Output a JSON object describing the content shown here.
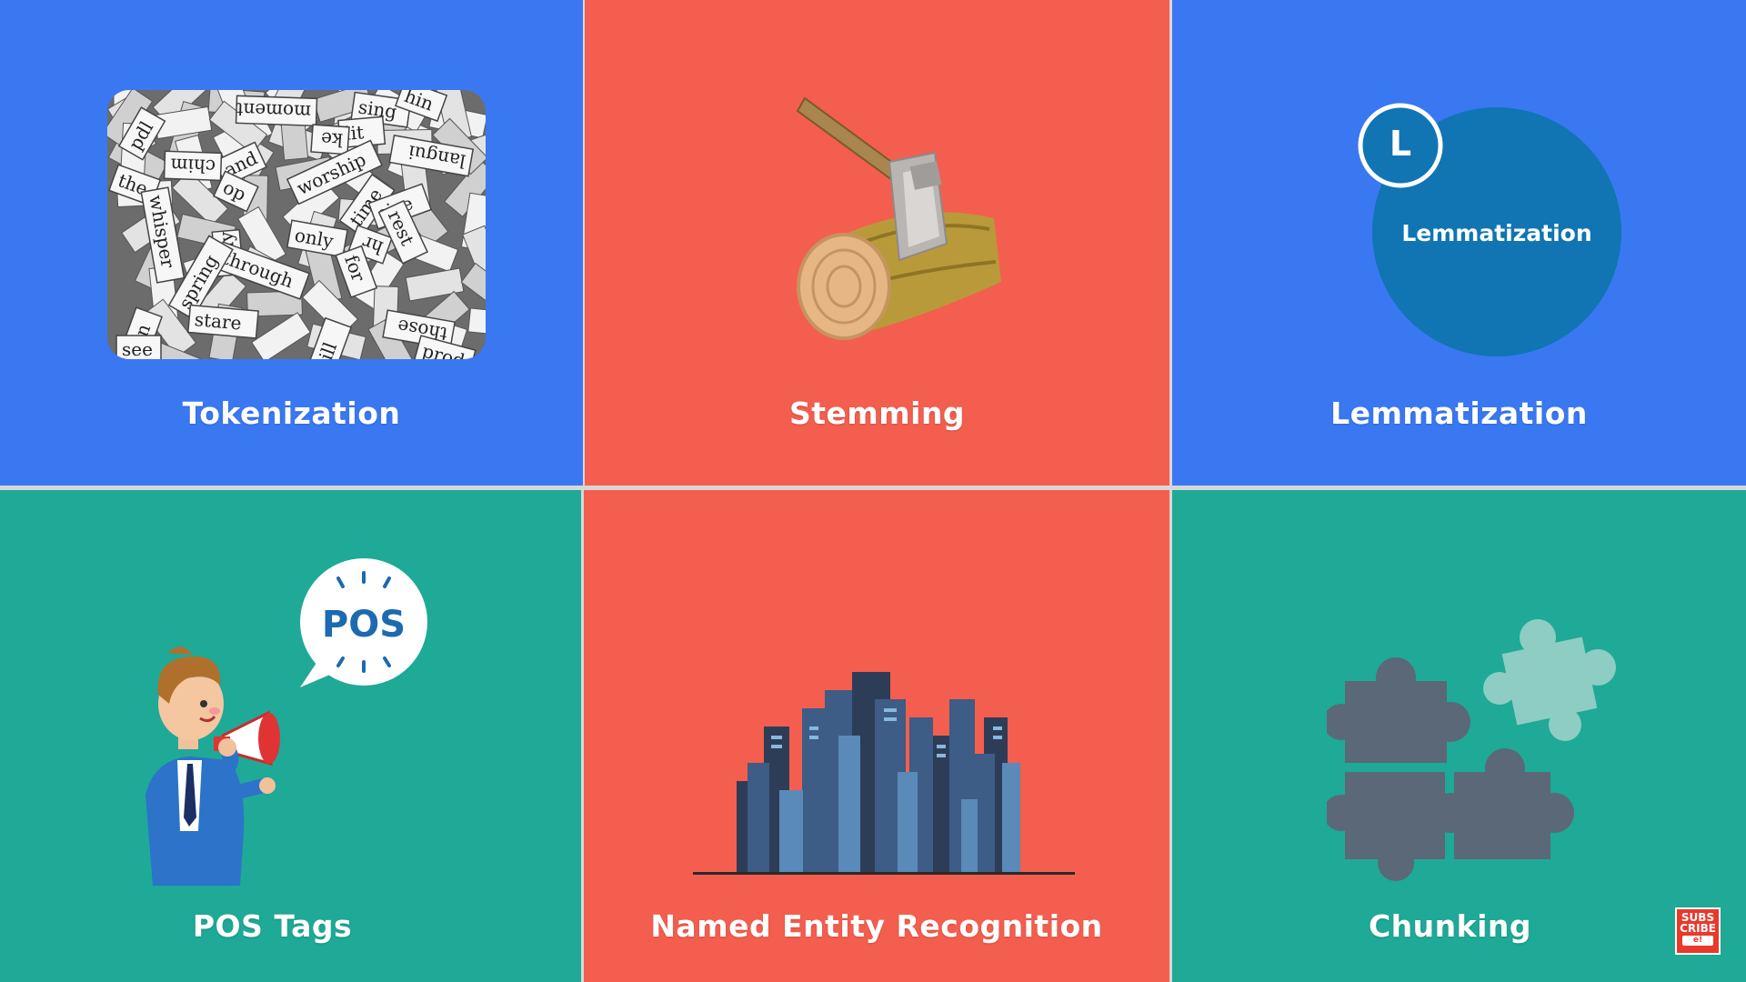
{
  "tiles": {
    "tokenization": {
      "caption": "Tokenization"
    },
    "stemming": {
      "caption": "Stemming"
    },
    "lemmatization": {
      "caption": "Lemmatization",
      "badge_letter": "L",
      "circle_text": "Lemmatization"
    },
    "pos_tags": {
      "caption": "POS Tags",
      "bubble_text": "POS"
    },
    "ner": {
      "caption": "Named Entity Recognition"
    },
    "chunking": {
      "caption": "Chunking"
    }
  },
  "word_tiles": [
    "moment",
    "sing",
    "hin",
    "pdl",
    "lit",
    "ke",
    "and",
    "langui",
    "chim",
    "the",
    "worship",
    "op",
    "time",
    "size",
    "whisper",
    "may",
    "only",
    "hr",
    "rest",
    "through",
    "spring",
    "for",
    "in",
    "stare",
    "ill",
    "those",
    "see",
    "prod"
  ],
  "subscribe_badge": {
    "line1": "SUBS",
    "line2": "CRIBE",
    "button": "e!"
  },
  "colors": {
    "blue_tile": "#3a78f2",
    "red_tile": "#f45e4e",
    "teal_tile": "#1fa997",
    "lemma_circle": "#1174b3",
    "divider": "#d7d7d7"
  }
}
